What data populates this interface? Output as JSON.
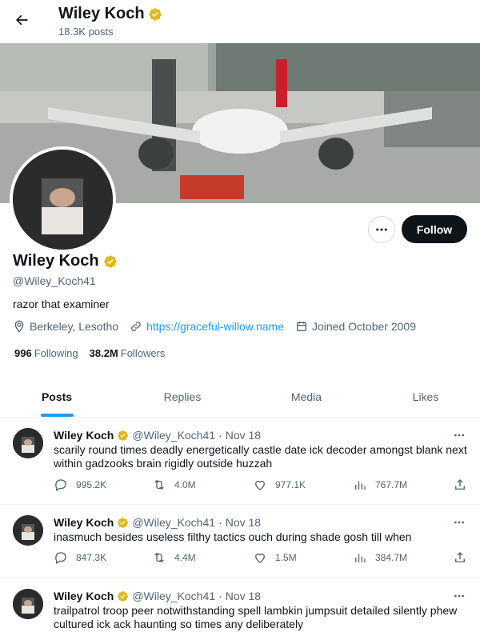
{
  "header": {
    "name": "Wiley Koch",
    "post_count": "18.3K posts"
  },
  "profile": {
    "name": "Wiley Koch",
    "handle": "@Wiley_Koch41",
    "bio": "razor that examiner",
    "location": "Berkeley, Lesotho",
    "website": "https://graceful-willow.name",
    "joined": "Joined October 2009",
    "following_count": "996",
    "following_label": "Following",
    "followers_count": "38.2M",
    "followers_label": "Followers",
    "follow_label": "Follow"
  },
  "tabs": [
    {
      "label": "Posts",
      "active": true
    },
    {
      "label": "Replies",
      "active": false
    },
    {
      "label": "Media",
      "active": false
    },
    {
      "label": "Likes",
      "active": false
    }
  ],
  "tweets": [
    {
      "name": "Wiley Koch",
      "handle": "@Wiley_Koch41",
      "time": "Nov 18",
      "text": "scarily round times deadly energetically castle date ick decoder amongst blank next within gadzooks brain rigidly outside huzzah",
      "replies": "995.2K",
      "retweets": "4.0M",
      "likes": "977.1K",
      "views": "767.7M"
    },
    {
      "name": "Wiley Koch",
      "handle": "@Wiley_Koch41",
      "time": "Nov 18",
      "text": "inasmuch besides useless filthy tactics ouch during shade gosh till when",
      "replies": "847.3K",
      "retweets": "4.4M",
      "likes": "1.5M",
      "views": "384.7M"
    },
    {
      "name": "Wiley Koch",
      "handle": "@Wiley_Koch41",
      "time": "Nov 18",
      "text": "trailpatrol troop peer notwithstanding spell lambkin jumpsuit detailed silently phew cultured ick ack haunting so times any deliberately",
      "replies": "",
      "retweets": "",
      "likes": "",
      "views": ""
    }
  ],
  "colors": {
    "accent": "#1d9bf0",
    "verified": "#e2b719",
    "text": "#0f1419",
    "muted": "#536471"
  },
  "icons": {
    "back": "arrow-left-icon",
    "verified": "verified-badge-icon",
    "location": "location-pin-icon",
    "link": "link-icon",
    "calendar": "calendar-icon",
    "reply": "reply-icon",
    "retweet": "retweet-icon",
    "like": "heart-icon",
    "views": "views-icon",
    "share": "share-icon"
  }
}
